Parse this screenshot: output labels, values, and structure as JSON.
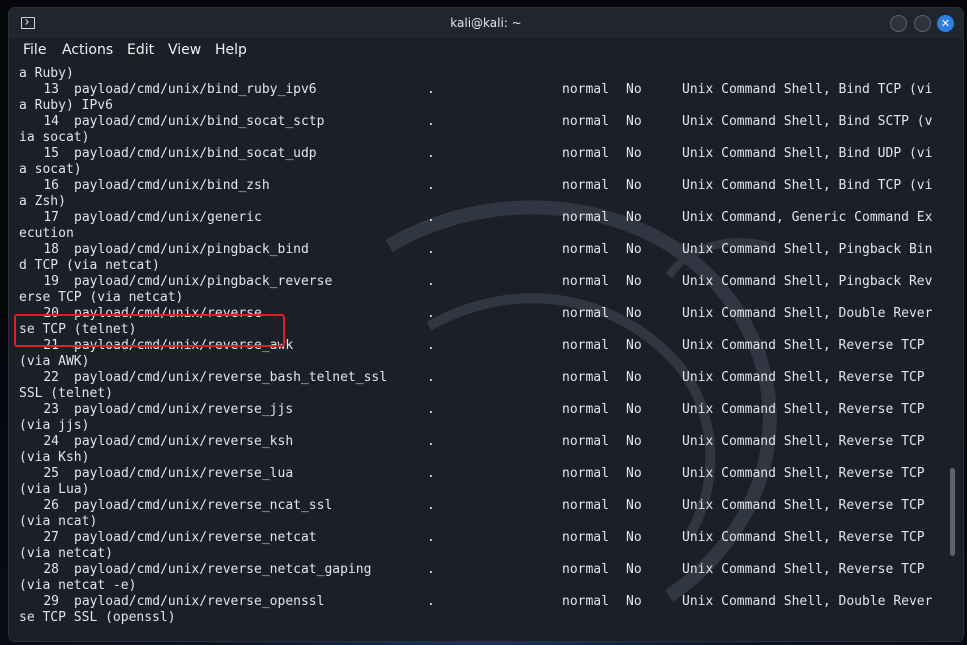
{
  "window": {
    "title": "kali@kali: ~"
  },
  "menu": [
    "File",
    "Actions",
    "Edit",
    "View",
    "Help"
  ],
  "terminal": {
    "leading_line": "a Ruby)",
    "rows": [
      {
        "num": "13",
        "path": "payload/cmd/unix/bind_ruby_ipv6",
        "date": ".",
        "rank": "normal",
        "check": "No",
        "desc": "Unix Command Shell, Bind TCP (vi",
        "cont": "a Ruby) IPv6"
      },
      {
        "num": "14",
        "path": "payload/cmd/unix/bind_socat_sctp",
        "date": ".",
        "rank": "normal",
        "check": "No",
        "desc": "Unix Command Shell, Bind SCTP (v",
        "cont": "ia socat)"
      },
      {
        "num": "15",
        "path": "payload/cmd/unix/bind_socat_udp",
        "date": ".",
        "rank": "normal",
        "check": "No",
        "desc": "Unix Command Shell, Bind UDP (vi",
        "cont": "a socat)"
      },
      {
        "num": "16",
        "path": "payload/cmd/unix/bind_zsh",
        "date": ".",
        "rank": "normal",
        "check": "No",
        "desc": "Unix Command Shell, Bind TCP (vi",
        "cont": "a Zsh)"
      },
      {
        "num": "17",
        "path": "payload/cmd/unix/generic",
        "date": ".",
        "rank": "normal",
        "check": "No",
        "desc": "Unix Command, Generic Command Ex",
        "cont": "ecution"
      },
      {
        "num": "18",
        "path": "payload/cmd/unix/pingback_bind",
        "date": ".",
        "rank": "normal",
        "check": "No",
        "desc": "Unix Command Shell, Pingback Bin",
        "cont": "d TCP (via netcat)"
      },
      {
        "num": "19",
        "path": "payload/cmd/unix/pingback_reverse",
        "date": ".",
        "rank": "normal",
        "check": "No",
        "desc": "Unix Command Shell, Pingback Rev",
        "cont": "erse TCP (via netcat)"
      },
      {
        "num": "20",
        "path": "payload/cmd/unix/reverse",
        "date": ".",
        "rank": "normal",
        "check": "No",
        "desc": "Unix Command Shell, Double Rever",
        "cont": "se TCP (telnet)"
      },
      {
        "num": "21",
        "path": "payload/cmd/unix/reverse_awk",
        "date": ".",
        "rank": "normal",
        "check": "No",
        "desc": "Unix Command Shell, Reverse TCP",
        "cont": "(via AWK)"
      },
      {
        "num": "22",
        "path": "payload/cmd/unix/reverse_bash_telnet_ssl",
        "date": ".",
        "rank": "normal",
        "check": "No",
        "desc": "Unix Command Shell, Reverse TCP",
        "cont": "SSL (telnet)"
      },
      {
        "num": "23",
        "path": "payload/cmd/unix/reverse_jjs",
        "date": ".",
        "rank": "normal",
        "check": "No",
        "desc": "Unix Command Shell, Reverse TCP",
        "cont": "(via jjs)"
      },
      {
        "num": "24",
        "path": "payload/cmd/unix/reverse_ksh",
        "date": ".",
        "rank": "normal",
        "check": "No",
        "desc": "Unix Command Shell, Reverse TCP",
        "cont": "(via Ksh)"
      },
      {
        "num": "25",
        "path": "payload/cmd/unix/reverse_lua",
        "date": ".",
        "rank": "normal",
        "check": "No",
        "desc": "Unix Command Shell, Reverse TCP",
        "cont": "(via Lua)"
      },
      {
        "num": "26",
        "path": "payload/cmd/unix/reverse_ncat_ssl",
        "date": ".",
        "rank": "normal",
        "check": "No",
        "desc": "Unix Command Shell, Reverse TCP",
        "cont": "(via ncat)"
      },
      {
        "num": "27",
        "path": "payload/cmd/unix/reverse_netcat",
        "date": ".",
        "rank": "normal",
        "check": "No",
        "desc": "Unix Command Shell, Reverse TCP",
        "cont": "(via netcat)"
      },
      {
        "num": "28",
        "path": "payload/cmd/unix/reverse_netcat_gaping",
        "date": ".",
        "rank": "normal",
        "check": "No",
        "desc": "Unix Command Shell, Reverse TCP",
        "cont": "(via netcat -e)"
      },
      {
        "num": "29",
        "path": "payload/cmd/unix/reverse_openssl",
        "date": ".",
        "rank": "normal",
        "check": "No",
        "desc": "Unix Command Shell, Double Rever",
        "cont": "se TCP SSL (openssl)"
      }
    ]
  },
  "colors": {
    "highlight": "#e02020",
    "close_button": "#2d7fe0",
    "terminal_bg": "#1b1f27"
  },
  "icons": [
    "terminal-icon",
    "minimize-icon",
    "maximize-icon",
    "close-icon"
  ]
}
